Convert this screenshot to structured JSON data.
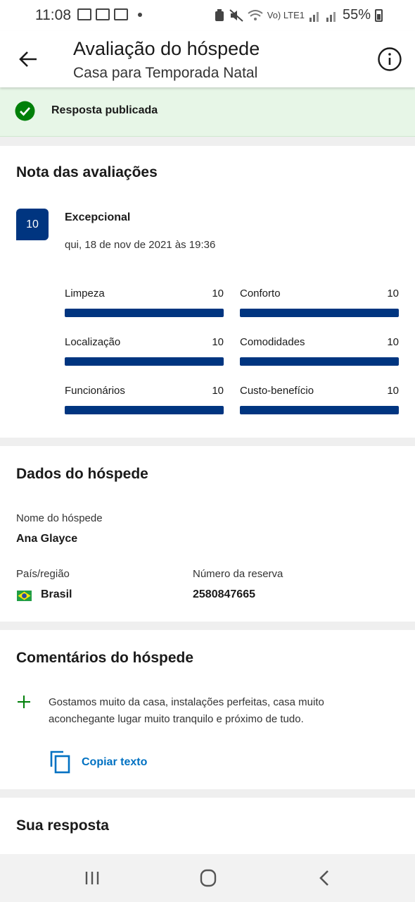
{
  "status_bar": {
    "time": "11:08",
    "network": "Vo) LTE1",
    "battery": "55%"
  },
  "header": {
    "title": "Avaliação do hóspede",
    "subtitle": "Casa para Temporada Natal",
    "back_icon": "arrow-left-icon",
    "info_icon": "info-icon"
  },
  "banner": {
    "text": "Resposta publicada",
    "icon": "check-circle-icon",
    "color": "#e7f6e7"
  },
  "scores": {
    "title": "Nota das avaliações",
    "overall_score": "10",
    "overall_label": "Excepcional",
    "date": "qui, 18 de nov de 2021 às 19:36",
    "bar_color": "#003580",
    "categories": [
      {
        "label": "Limpeza",
        "value": "10",
        "fraction": 1.0
      },
      {
        "label": "Conforto",
        "value": "10",
        "fraction": 1.0
      },
      {
        "label": "Localização",
        "value": "10",
        "fraction": 1.0
      },
      {
        "label": "Comodidades",
        "value": "10",
        "fraction": 1.0
      },
      {
        "label": "Funcionários",
        "value": "10",
        "fraction": 1.0
      },
      {
        "label": "Custo-benefício",
        "value": "10",
        "fraction": 1.0
      }
    ]
  },
  "guest": {
    "title": "Dados do hóspede",
    "name_label": "Nome do hóspede",
    "name": "Ana Glayce",
    "country_label": "País/região",
    "country": "Brasil",
    "country_flag": "brazil-flag-icon",
    "booking_label": "Número da reserva",
    "booking_number": "2580847665"
  },
  "comments": {
    "title": "Comentários do hóspede",
    "positive_text": "Gostamos muito da casa, instalações perfeitas, casa muito aconchegante lugar muito tranquilo e próximo de tudo.",
    "copy_label": "Copiar texto",
    "accent_color": "#0071c2"
  },
  "reply": {
    "title": "Sua resposta"
  },
  "nav": {
    "recent_icon": "recent-apps-icon",
    "home_icon": "home-icon",
    "back_icon": "back-chevron-icon"
  }
}
